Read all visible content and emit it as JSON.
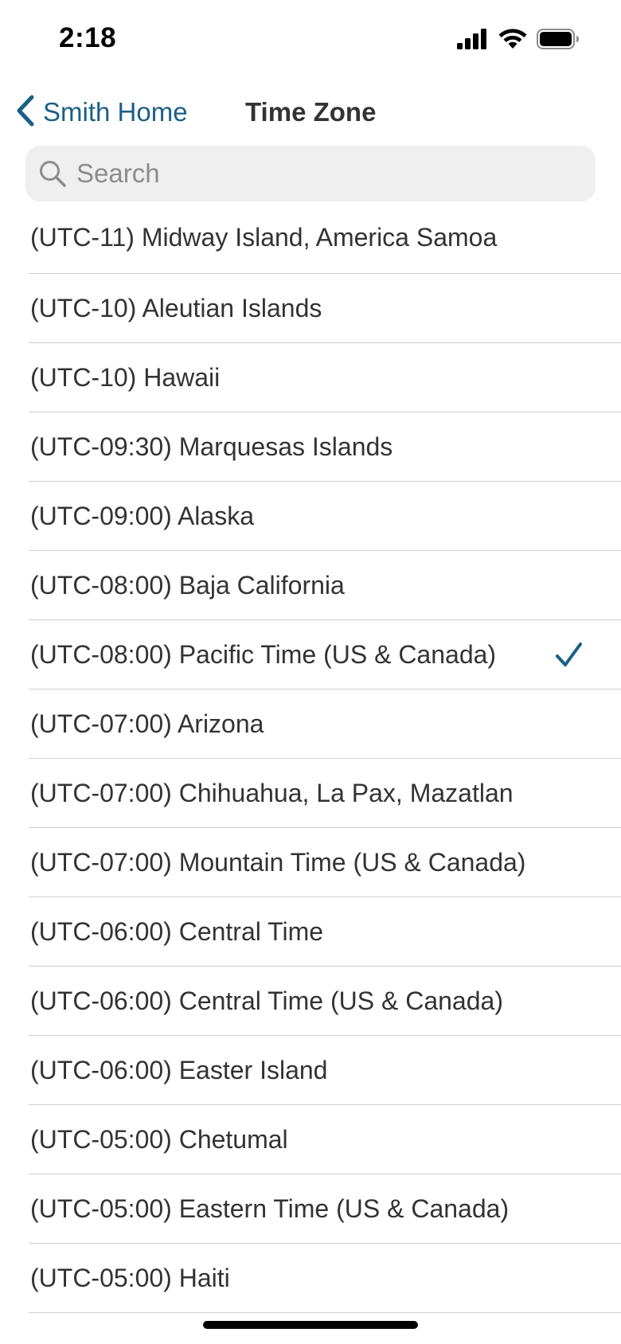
{
  "status_bar": {
    "time": "2:18",
    "icons": [
      "cellular-signal-icon",
      "wifi-icon",
      "battery-icon"
    ]
  },
  "nav": {
    "back_label": "Smith Home",
    "title": "Time Zone"
  },
  "search": {
    "placeholder": "Search",
    "value": ""
  },
  "colors": {
    "accent": "#1b5f86",
    "separator": "#cfcfcf",
    "search_bg": "#efefef"
  },
  "time_zones": [
    {
      "label": "(UTC-11) Midway Island, America Samoa",
      "selected": false
    },
    {
      "label": "(UTC-10) Aleutian Islands",
      "selected": false
    },
    {
      "label": "(UTC-10) Hawaii",
      "selected": false
    },
    {
      "label": "(UTC-09:30) Marquesas Islands",
      "selected": false
    },
    {
      "label": "(UTC-09:00) Alaska",
      "selected": false
    },
    {
      "label": "(UTC-08:00) Baja California",
      "selected": false
    },
    {
      "label": "(UTC-08:00) Pacific Time (US & Canada)",
      "selected": true
    },
    {
      "label": "(UTC-07:00) Arizona",
      "selected": false
    },
    {
      "label": "(UTC-07:00) Chihuahua, La Pax, Mazatlan",
      "selected": false
    },
    {
      "label": "(UTC-07:00) Mountain Time (US & Canada)",
      "selected": false
    },
    {
      "label": "(UTC-06:00) Central Time",
      "selected": false
    },
    {
      "label": "(UTC-06:00) Central Time (US & Canada)",
      "selected": false
    },
    {
      "label": "(UTC-06:00) Easter Island",
      "selected": false
    },
    {
      "label": "(UTC-05:00) Chetumal",
      "selected": false
    },
    {
      "label": "(UTC-05:00) Eastern Time (US & Canada)",
      "selected": false
    },
    {
      "label": "(UTC-05:00) Haiti",
      "selected": false
    }
  ]
}
